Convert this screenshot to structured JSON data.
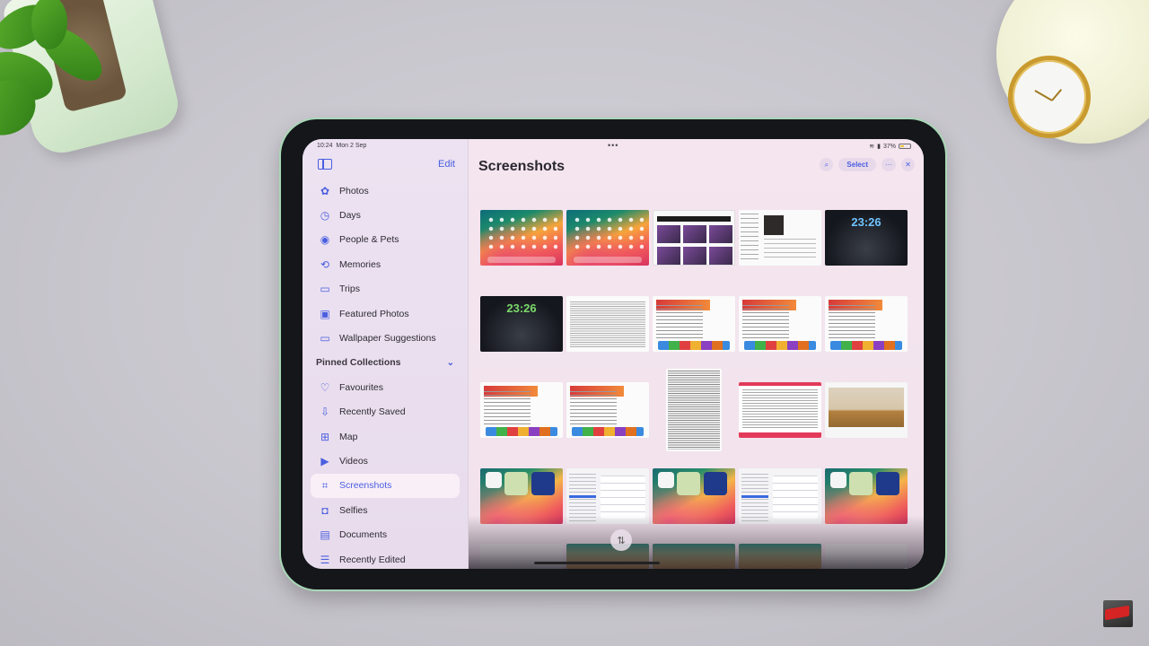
{
  "status_bar": {
    "time": "10:24",
    "date": "Mon 2 Sep",
    "battery_percent": "37%",
    "multitask_indicator": "•••"
  },
  "sidebar": {
    "toggle_icon": "sidebar-toggle-icon",
    "edit_label": "Edit",
    "items": [
      {
        "label": "Photos",
        "icon": "photos-flower-icon",
        "glyph": "✿"
      },
      {
        "label": "Days",
        "icon": "clock-icon",
        "glyph": "◷"
      },
      {
        "label": "People & Pets",
        "icon": "person-circle-icon",
        "glyph": "◉"
      },
      {
        "label": "Memories",
        "icon": "memories-play-icon",
        "glyph": "⟲"
      },
      {
        "label": "Trips",
        "icon": "suitcase-icon",
        "glyph": "▭"
      },
      {
        "label": "Featured Photos",
        "icon": "photo-icon",
        "glyph": "▣"
      },
      {
        "label": "Wallpaper Suggestions",
        "icon": "display-icon",
        "glyph": "▭"
      }
    ],
    "pinned_section": {
      "label": "Pinned Collections",
      "chevron_icon": "chevron-down-icon",
      "chevron_glyph": "⌄",
      "items": [
        {
          "label": "Favourites",
          "icon": "heart-icon",
          "glyph": "♡",
          "active": false
        },
        {
          "label": "Recently Saved",
          "icon": "tray-download-icon",
          "glyph": "⇩",
          "active": false
        },
        {
          "label": "Map",
          "icon": "map-icon",
          "glyph": "⊞",
          "active": false
        },
        {
          "label": "Videos",
          "icon": "video-camera-icon",
          "glyph": "▶",
          "active": false
        },
        {
          "label": "Screenshots",
          "icon": "screenshot-camera-icon",
          "glyph": "⌗",
          "active": true
        },
        {
          "label": "Selfies",
          "icon": "selfie-person-icon",
          "glyph": "◘",
          "active": false
        },
        {
          "label": "Documents",
          "icon": "document-icon",
          "glyph": "▤",
          "active": false
        },
        {
          "label": "Recently Edited",
          "icon": "sliders-icon",
          "glyph": "☰",
          "active": false
        }
      ]
    }
  },
  "main": {
    "title": "Screenshots",
    "toolbar": {
      "search_glyph": "⌕",
      "select_label": "Select",
      "more_glyph": "···",
      "close_glyph": "✕"
    },
    "thumbnails": [
      {
        "kind": "home",
        "desc": "iPad home screen"
      },
      {
        "kind": "home",
        "desc": "iPad home screen"
      },
      {
        "kind": "web",
        "desc": "Web page grid"
      },
      {
        "kind": "music",
        "desc": "Music album page"
      },
      {
        "kind": "dark",
        "desc": "Lock screen clock",
        "clock": "23:26",
        "clock_color": "#6fc3ff"
      },
      {
        "kind": "dark",
        "desc": "StandBy clock",
        "clock": "23:26",
        "clock_color": "#7bd86a"
      },
      {
        "kind": "text",
        "desc": "Text document"
      },
      {
        "kind": "article",
        "desc": "Article page"
      },
      {
        "kind": "article",
        "desc": "Article page"
      },
      {
        "kind": "article",
        "desc": "Article page"
      },
      {
        "kind": "article",
        "desc": "Article page"
      },
      {
        "kind": "article",
        "desc": "Article page"
      },
      {
        "kind": "tall",
        "desc": "Long text document"
      },
      {
        "kind": "pinkdoc",
        "desc": "Document with pink border"
      },
      {
        "kind": "room",
        "desc": "Room photo"
      },
      {
        "kind": "widget",
        "desc": "Home screen with widgets"
      },
      {
        "kind": "settings",
        "desc": "Settings screen"
      },
      {
        "kind": "widget",
        "desc": "Home screen with widgets"
      },
      {
        "kind": "settings",
        "desc": "Settings screen"
      },
      {
        "kind": "widget",
        "desc": "Home screen with widgets"
      }
    ],
    "sort_glyph": "⇅"
  }
}
